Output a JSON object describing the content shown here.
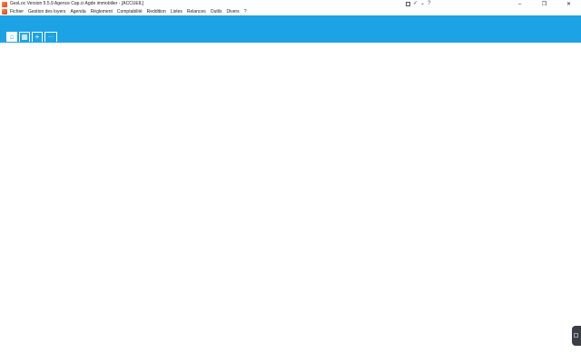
{
  "window": {
    "title": "GesLoc  Version 5.5.9  Agence Cap.ci Agde immobilier - [ACCUEIL]",
    "controls": {
      "minimize": "–",
      "maximize": "❐",
      "close": "✕"
    },
    "title_tools": {
      "check": "✓",
      "dropdown": "⌄",
      "help": "?"
    }
  },
  "menu": {
    "items": [
      "Fichier",
      "Gestion des loyers",
      "Agenda",
      "Règlement",
      "Comptabilité",
      "Reddition",
      "Listes",
      "Relances",
      "Outils",
      "Divers",
      "?"
    ]
  },
  "ribbon": {
    "accent_color": "#1da2e6",
    "tabs": [
      {
        "icon": "home-icon",
        "glyph": "⌂"
      },
      {
        "icon": "calendar-icon",
        "glyph": "▦"
      },
      {
        "icon": "plus-icon",
        "glyph": "+"
      },
      {
        "icon": "more-icon",
        "glyph": "···"
      }
    ]
  }
}
